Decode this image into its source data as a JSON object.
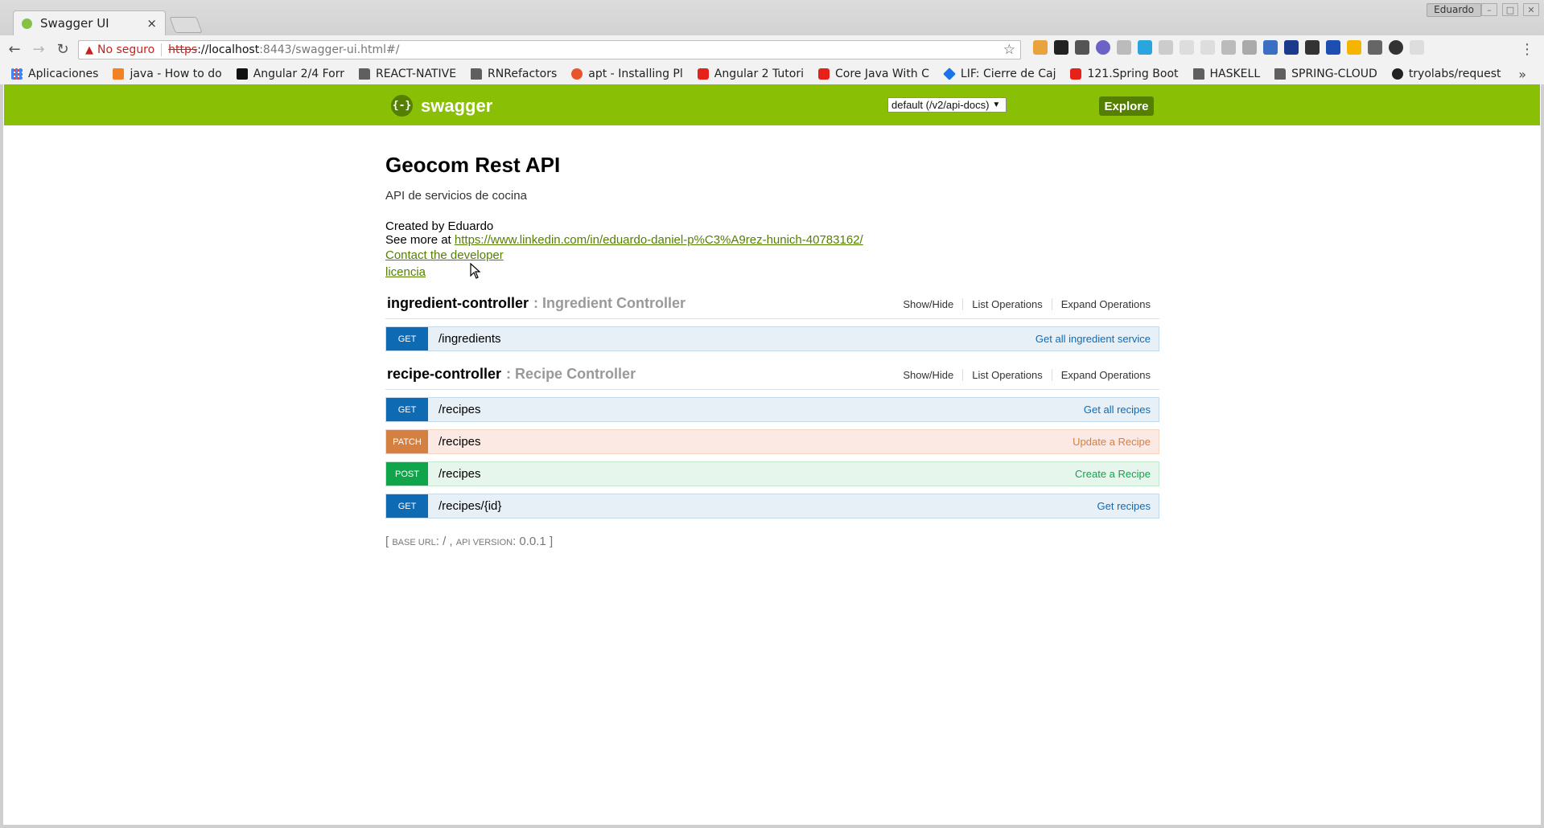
{
  "browser": {
    "tab_title": "Swagger UI",
    "tab_close": "×",
    "user": "Eduardo",
    "omnibox": {
      "not_secure": "No seguro",
      "scheme": "https",
      "host": "://localhost",
      "path": ":8443/swagger-ui.html#/"
    },
    "bookmarks": [
      {
        "label": "Aplicaciones",
        "icon": "apps-grid-icon"
      },
      {
        "label": "java - How to do",
        "icon": "stackoverflow-icon"
      },
      {
        "label": "Angular 2/4 Forr",
        "icon": "cp-icon"
      },
      {
        "label": "REACT-NATIVE",
        "icon": "folder-icon"
      },
      {
        "label": "RNRefactors",
        "icon": "folder-icon"
      },
      {
        "label": "apt - Installing Pl",
        "icon": "ask-icon"
      },
      {
        "label": "Angular 2 Tutori",
        "icon": "youtube-icon"
      },
      {
        "label": "Core Java With C",
        "icon": "youtube-icon"
      },
      {
        "label": "LIF: Cierre de Caj",
        "icon": "diamond-icon"
      },
      {
        "label": "121.Spring Boot",
        "icon": "youtube-icon"
      },
      {
        "label": "HASKELL",
        "icon": "folder-icon"
      },
      {
        "label": "SPRING-CLOUD",
        "icon": "folder-icon"
      },
      {
        "label": "tryolabs/request",
        "icon": "github-icon"
      }
    ]
  },
  "swagger": {
    "logo_text": "swagger",
    "logo_mark": "{-}",
    "spec_select": "default (/v2/api-docs)",
    "explore_label": "Explore"
  },
  "info": {
    "title": "Geocom Rest API",
    "description": "API de servicios de cocina",
    "created_by": "Created by Eduardo",
    "see_more_prefix": "See more at ",
    "see_more_url": "https://www.linkedin.com/in/eduardo-daniel-p%C3%A9rez-hunich-40783162/",
    "contact": "Contact the developer",
    "license": "licencia"
  },
  "resources": [
    {
      "name": "ingredient-controller",
      "description": ": Ingredient Controller",
      "ops_labels": [
        "Show/Hide",
        "List Operations",
        "Expand Operations"
      ],
      "operations": [
        {
          "method": "GET",
          "path": "/ingredients",
          "summary": "Get all ingredient service"
        }
      ]
    },
    {
      "name": "recipe-controller",
      "description": ": Recipe Controller",
      "ops_labels": [
        "Show/Hide",
        "List Operations",
        "Expand Operations"
      ],
      "operations": [
        {
          "method": "GET",
          "path": "/recipes",
          "summary": "Get all recipes"
        },
        {
          "method": "PATCH",
          "path": "/recipes",
          "summary": "Update a Recipe"
        },
        {
          "method": "POST",
          "path": "/recipes",
          "summary": "Create a Recipe"
        },
        {
          "method": "GET",
          "path": "/recipes/{id}",
          "summary": "Get recipes"
        }
      ]
    }
  ],
  "footer": {
    "open": "[ ",
    "base_url_label": "base url",
    "base_url_value": ": / , ",
    "api_version_label": "api version",
    "api_version_value": ": 0.0.1 ",
    "close": "]"
  },
  "colors": {
    "swagger_green": "#89bf04",
    "get": "#0f6ab4",
    "patch": "#d38042",
    "post": "#10a54a"
  }
}
